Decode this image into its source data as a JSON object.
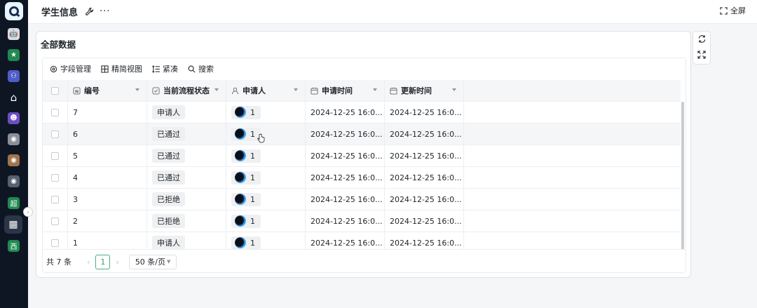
{
  "sidebar": {
    "logo": "Q",
    "items": [
      {
        "name": "robot-icon",
        "glyph": "🤖",
        "color": "#d9dde3"
      },
      {
        "name": "star-icon",
        "glyph": "★",
        "color": "#1f8a50"
      },
      {
        "name": "team-icon",
        "glyph": "⚇",
        "color": "#4e5cc8"
      },
      {
        "name": "home-icon",
        "glyph": "⌂",
        "color": "transparent"
      },
      {
        "name": "app-purple-icon",
        "glyph": "☻",
        "color": "#6a4fc2"
      },
      {
        "name": "avatar-app-icon-1",
        "glyph": "◉",
        "color": "#8a8f98"
      },
      {
        "name": "avatar-app-icon-2",
        "glyph": "◉",
        "color": "#a0744b"
      },
      {
        "name": "avatar-app-icon-3",
        "glyph": "◉",
        "color": "#556070"
      },
      {
        "name": "super-app-icon",
        "glyph": "超",
        "color": "#1f8a50"
      },
      {
        "name": "apps-grid-icon",
        "glyph": "▦",
        "color": "transparent"
      },
      {
        "name": "west-app-icon",
        "glyph": "西",
        "color": "#1f8a50"
      }
    ]
  },
  "header": {
    "title": "学生信息",
    "fullscreen_label": "全屏"
  },
  "card": {
    "title": "全部数据"
  },
  "toolbar": {
    "fields": "字段管理",
    "simple_view": "精简视图",
    "compact": "紧凑",
    "search": "搜索"
  },
  "table": {
    "columns": [
      "编号",
      "当前流程状态",
      "申请人",
      "申请时间",
      "更新时间"
    ],
    "rows": [
      {
        "id": "7",
        "status": "申请人",
        "applicant": "1",
        "apply_time": "2024-12-25 16:0...",
        "update_time": "2024-12-25 16:0..."
      },
      {
        "id": "6",
        "status": "已通过",
        "applicant": "1",
        "apply_time": "2024-12-25 16:0...",
        "update_time": "2024-12-25 16:0..."
      },
      {
        "id": "5",
        "status": "已通过",
        "applicant": "1",
        "apply_time": "2024-12-25 16:0...",
        "update_time": "2024-12-25 16:0..."
      },
      {
        "id": "4",
        "status": "已通过",
        "applicant": "1",
        "apply_time": "2024-12-25 16:0...",
        "update_time": "2024-12-25 16:0..."
      },
      {
        "id": "3",
        "status": "已拒绝",
        "applicant": "1",
        "apply_time": "2024-12-25 16:0...",
        "update_time": "2024-12-25 16:0..."
      },
      {
        "id": "2",
        "status": "已拒绝",
        "applicant": "1",
        "apply_time": "2024-12-25 16:0...",
        "update_time": "2024-12-25 16:0..."
      },
      {
        "id": "1",
        "status": "申请人",
        "applicant": "1",
        "apply_time": "2024-12-25 16:0...",
        "update_time": "2024-12-25 16:0..."
      }
    ]
  },
  "pagination": {
    "total": "共 7 条",
    "current_page": "1",
    "page_size": "50 条/页"
  }
}
